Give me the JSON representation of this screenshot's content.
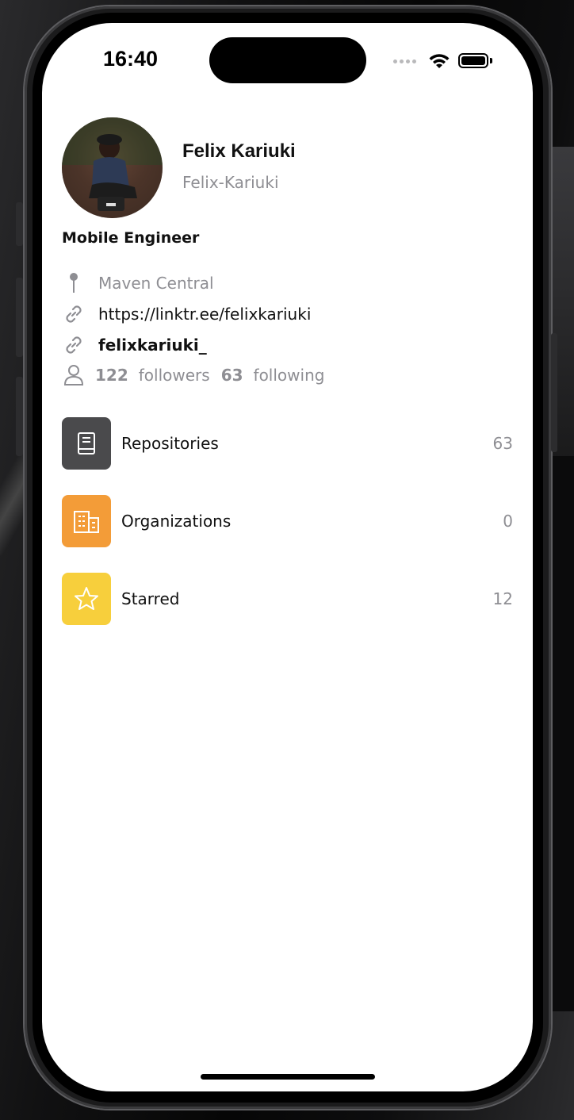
{
  "status_bar": {
    "time": "16:40"
  },
  "profile": {
    "name": "Felix Kariuki",
    "login": "Felix-Kariuki",
    "bio": "Mobile Engineer",
    "location": "Maven Central",
    "blog": "https://linktr.ee/felixkariuki",
    "twitter": "felixkariuki_",
    "followers_count": "122",
    "followers_label": "followers",
    "following_count": "63",
    "following_label": "following"
  },
  "menu": [
    {
      "label": "Repositories",
      "count": "63",
      "icon": "book-icon",
      "color": "#4a4a4c"
    },
    {
      "label": "Organizations",
      "count": "0",
      "icon": "building-icon",
      "color": "#f39c38"
    },
    {
      "label": "Starred",
      "count": "12",
      "icon": "star-icon",
      "color": "#f7cf3c"
    }
  ]
}
